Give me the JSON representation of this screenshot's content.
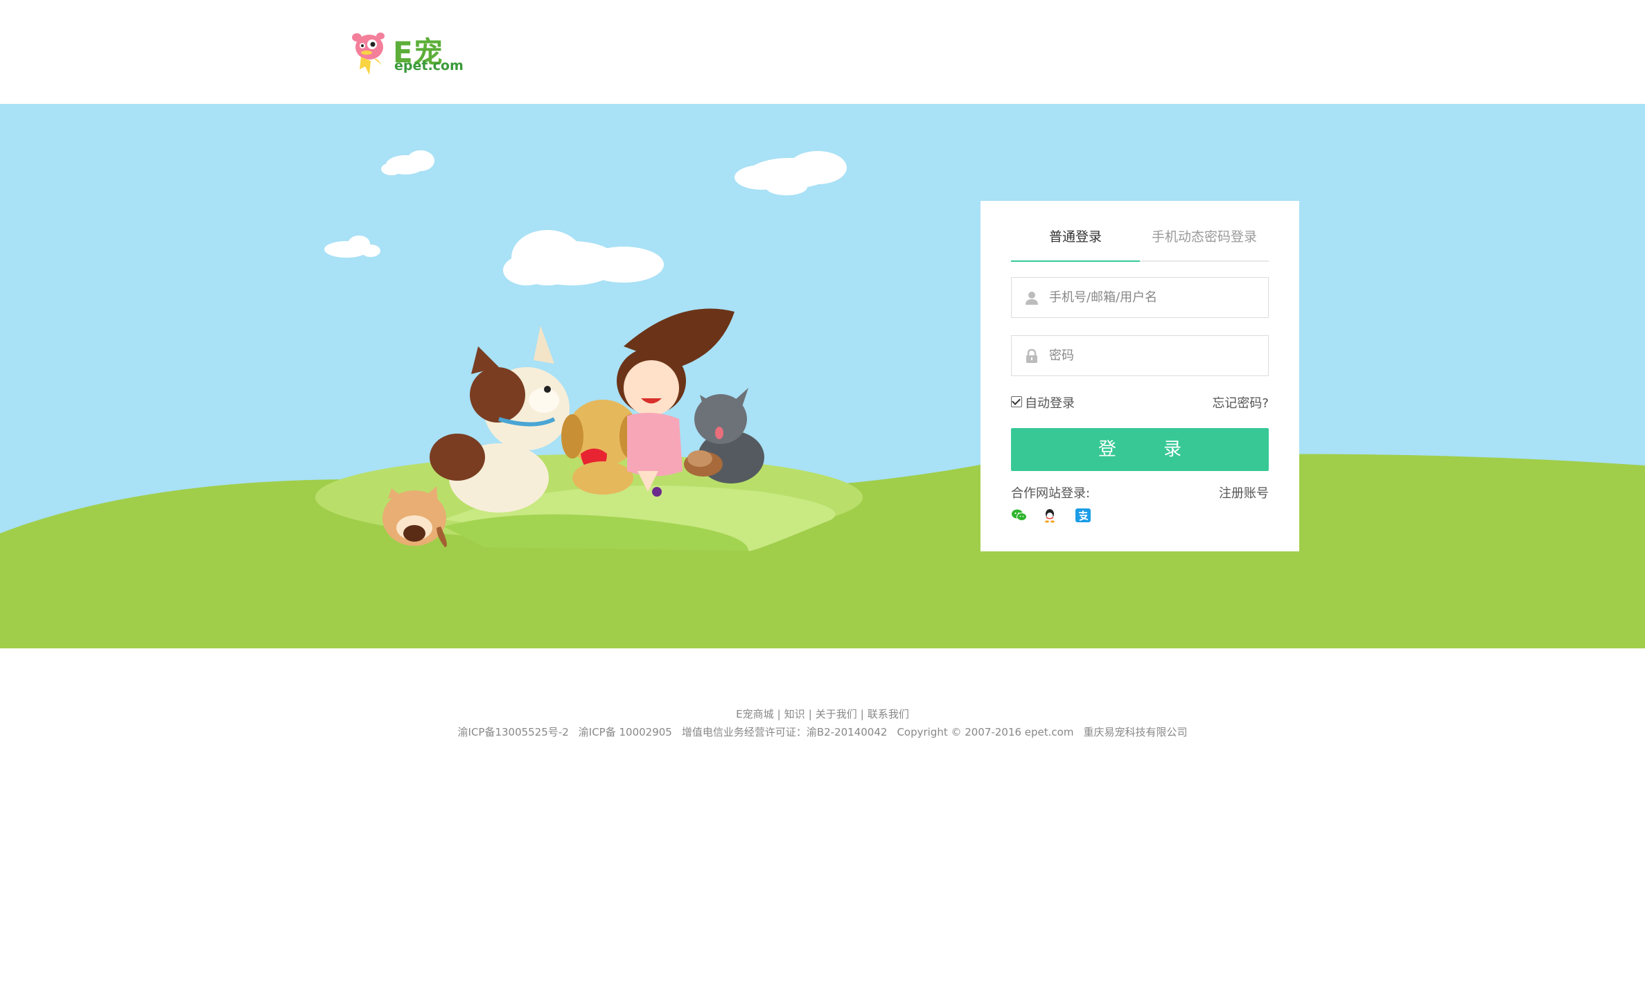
{
  "brand": {
    "name": "E宠",
    "domain": "epet.com",
    "colors": {
      "primary": "#37c896",
      "logo_green": "#5cae38",
      "sky": "#a9e1f6",
      "grass": "#a0ce4b"
    }
  },
  "login": {
    "tabs": [
      {
        "label": "普通登录",
        "active": true
      },
      {
        "label": "手机动态密码登录",
        "active": false
      }
    ],
    "username": {
      "placeholder": "手机号/邮箱/用户名",
      "value": "",
      "icon": "user-icon"
    },
    "password": {
      "placeholder": "密码",
      "value": "",
      "icon": "lock-icon"
    },
    "auto_login": {
      "label": "自动登录",
      "checked": true
    },
    "forgot_label": "忘记密码?",
    "submit_label": "登 录",
    "coop_label": "合作网站登录:",
    "register_label": "注册账号",
    "social": [
      {
        "name": "wechat",
        "icon": "wechat-icon"
      },
      {
        "name": "qq",
        "icon": "qq-icon"
      },
      {
        "name": "alipay",
        "icon": "alipay-icon"
      }
    ]
  },
  "footer": {
    "links": [
      "E宠商城",
      "知识",
      "关于我们",
      "联系我们"
    ],
    "separator": "|",
    "icp1": "渝ICP备13005525号-2",
    "icp2": "渝ICP备 10002905",
    "license": "增值电信业务经营许可证：渝B2-20140042",
    "copyright": "Copyright © 2007-2016 epet.com",
    "company": "重庆易宠科技有限公司"
  }
}
